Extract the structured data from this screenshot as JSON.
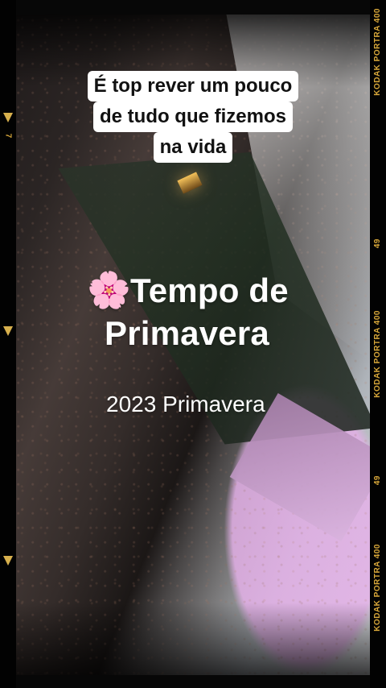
{
  "caption": {
    "line1": "É top rever um pouco",
    "line2": "de tudo que fizemos",
    "line3": "na vida"
  },
  "title": {
    "icon": "cherry-blossom-icon",
    "line1": "Tempo de",
    "line2": "Primavera"
  },
  "subtitle": "2023 Primavera",
  "film": {
    "left_number": "7",
    "right_top": "KODAK PORTRA 400",
    "right_mid_num": "49",
    "right_mid": "KODAK PORTRA 400",
    "right_mid_num_2": "49",
    "right_bottom": "KODAK PORTRA 400"
  }
}
